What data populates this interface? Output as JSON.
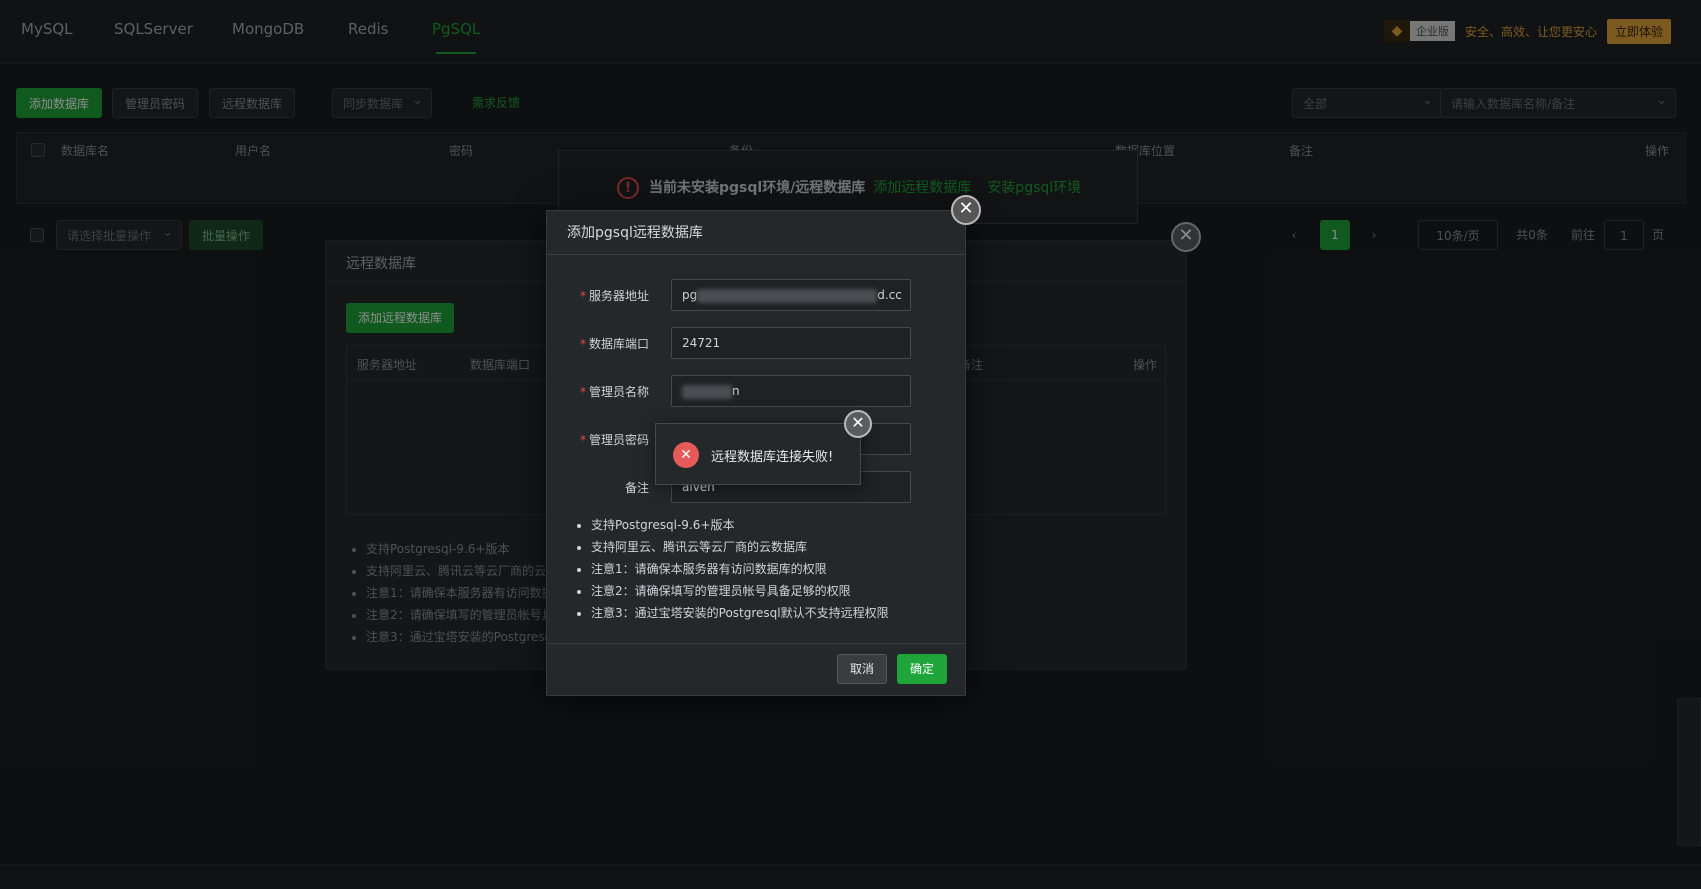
{
  "tabs": [
    {
      "label": "MySQL"
    },
    {
      "label": "SQLServer"
    },
    {
      "label": "MongoDB"
    },
    {
      "label": "Redis"
    },
    {
      "label": "PgSQL"
    }
  ],
  "enterprise": {
    "tag": "企业版",
    "slogan": "安全、高效、让您更安心",
    "try_label": "立即体验"
  },
  "toolbar": {
    "add_db": "添加数据库",
    "admin_pwd": "管理员密码",
    "remote_db": "远程数据库",
    "sync_db": "同步数据库",
    "feedback": "需求反馈",
    "filter_value": "全部",
    "search_placeholder": "请输入数据库名称/备注"
  },
  "table": {
    "headers": [
      "数据库名",
      "用户名",
      "密码",
      "备份",
      "数据库位置",
      "备注",
      "操作"
    ]
  },
  "warning": {
    "text": "当前未安装pgsql环境/远程数据库",
    "link1": "添加远程数据库",
    "link2": "安装pgsql环境"
  },
  "batch": {
    "select_placeholder": "请选择批量操作",
    "button": "批量操作"
  },
  "pager": {
    "current": "1",
    "per_page": "10条/页",
    "total": "共0条",
    "goto": "前往",
    "goto_value": "1",
    "page_unit": "页"
  },
  "remote_panel": {
    "title": "远程数据库",
    "add_button": "添加远程数据库",
    "headers": [
      "服务器地址",
      "数据库端口",
      "备注",
      "操作"
    ],
    "notes": [
      "支持Postgresql-9.6+版本",
      "支持阿里云、腾讯云等云厂商的云",
      "注意1：请确保本服务器有访问数据",
      "注意2：请确保填写的管理员帐号具",
      "注意3：通过宝塔安装的Postgresq"
    ]
  },
  "modal": {
    "title": "添加pgsql远程数据库",
    "fields": {
      "server_label": "服务器地址",
      "server_prefix": "pg",
      "server_suffix": "d.cc",
      "port_label": "数据库端口",
      "port_value": "24721",
      "admin_label": "管理员名称",
      "admin_suffix": "n",
      "password_label": "管理员密码",
      "remark_label": "备注",
      "remark_value": "aiven"
    },
    "notes": [
      "支持Postgresql-9.6+版本",
      "支持阿里云、腾讯云等云厂商的云数据库",
      "注意1：请确保本服务器有访问数据库的权限",
      "注意2：请确保填写的管理员帐号具备足够的权限",
      "注意3：通过宝塔安装的Postgresql默认不支持远程权限"
    ],
    "cancel": "取消",
    "confirm": "确定"
  },
  "toast": {
    "message": "远程数据库连接失败!"
  },
  "colors": {
    "accent": "#20a53a",
    "error": "#e65a5a",
    "gold": "#e0a43c"
  }
}
